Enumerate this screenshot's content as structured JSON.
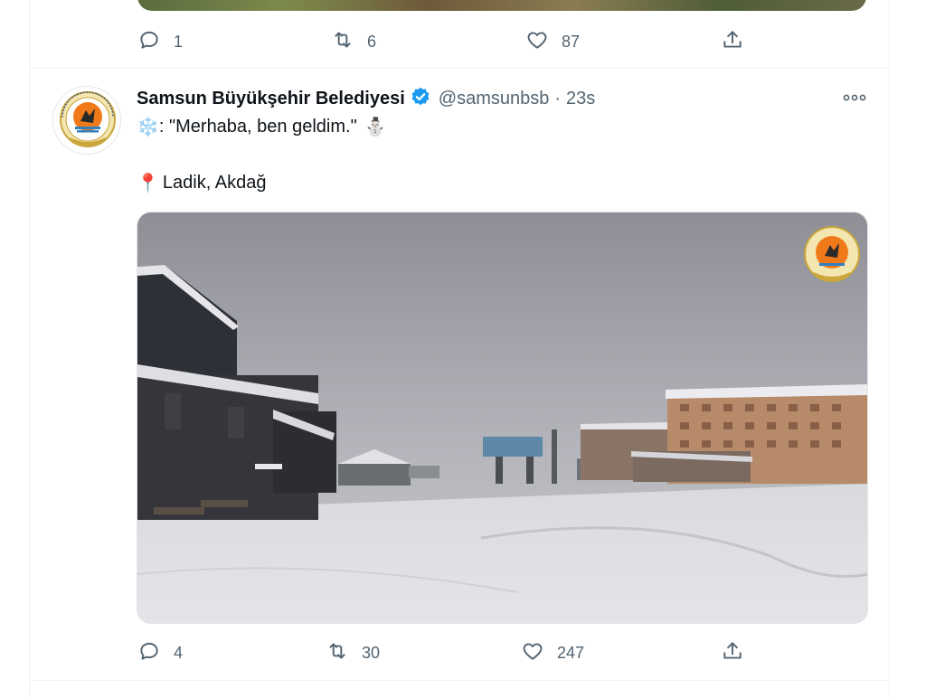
{
  "previous_tweet": {
    "actions": {
      "reply_count": "1",
      "retweet_count": "6",
      "like_count": "87"
    }
  },
  "tweet": {
    "author_name": "Samsun Büyükşehir Belediyesi",
    "handle": "@samsunbsb",
    "separator": "·",
    "time": "23s",
    "text_line1_emoji": "❄️",
    "text_line1": ": \"Merhaba, ben geldim.\"",
    "text_line1_end_emoji": "⛄",
    "location_emoji": "📍",
    "location": "Ladik, Akdağ",
    "actions": {
      "reply_count": "4",
      "retweet_count": "30",
      "like_count": "247"
    }
  },
  "icons": {
    "reply": "reply-icon",
    "retweet": "retweet-icon",
    "like": "heart-icon",
    "share": "share-icon",
    "more": "more-icon",
    "verified": "verified-badge-icon"
  },
  "colors": {
    "text_primary": "#0f1419",
    "text_secondary": "#536471",
    "verified_blue": "#1d9bf0",
    "divider": "#eff3f4"
  }
}
